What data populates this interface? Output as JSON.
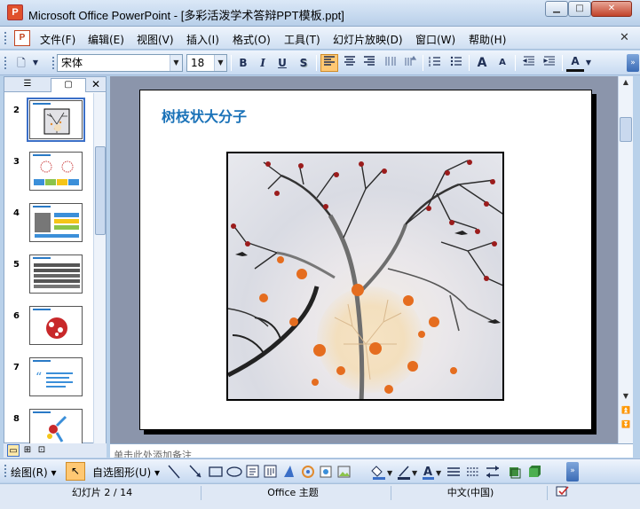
{
  "window": {
    "title": "Microsoft Office PowerPoint - [多彩活泼学术答辩PPT模板.ppt]",
    "min_glyph": "▁",
    "max_glyph": "□",
    "close_glyph": "✕",
    "app_icon_letter": "P"
  },
  "menu": {
    "doc_icon_letter": "P",
    "items": [
      "文件(F)",
      "编辑(E)",
      "视图(V)",
      "插入(I)",
      "格式(O)",
      "工具(T)",
      "幻灯片放映(D)",
      "窗口(W)",
      "帮助(H)"
    ],
    "close_glyph": "✕"
  },
  "format_toolbar": {
    "font_name": "宋体",
    "font_size": "18",
    "dropdown_glyph": "▼",
    "bold": "B",
    "italic": "I",
    "underline": "U",
    "shadow": "S",
    "font_color_letter": "A",
    "grow_font": "A",
    "shrink_font": "A",
    "new_glyph": "🗋",
    "align_left_active": true
  },
  "left_pane": {
    "outline_tab_glyph": "☰",
    "slides_tab_glyph": "▢",
    "close_glyph": "✕",
    "thumbnails": [
      {
        "number": "2",
        "selected": true
      },
      {
        "number": "3",
        "selected": false
      },
      {
        "number": "4",
        "selected": false
      },
      {
        "number": "5",
        "selected": false
      },
      {
        "number": "6",
        "selected": false
      },
      {
        "number": "7",
        "selected": false
      },
      {
        "number": "8",
        "selected": false
      }
    ]
  },
  "slide": {
    "title": "树枝状大分子",
    "title_color": "#1a72b8"
  },
  "notes": {
    "placeholder": "单击此处添加备注"
  },
  "drawing_toolbar": {
    "draw_menu": "绘图(R)",
    "autoshapes_menu": "自选图形(U)"
  },
  "status_bar": {
    "slide_position": "幻灯片 2 / 14",
    "design": "Office 主题",
    "language": "中文(中国)"
  },
  "colors": {
    "accent_blue": "#1a72b8",
    "active_button": "#ffc873",
    "toolbar_bg": "#dfe8f5"
  }
}
